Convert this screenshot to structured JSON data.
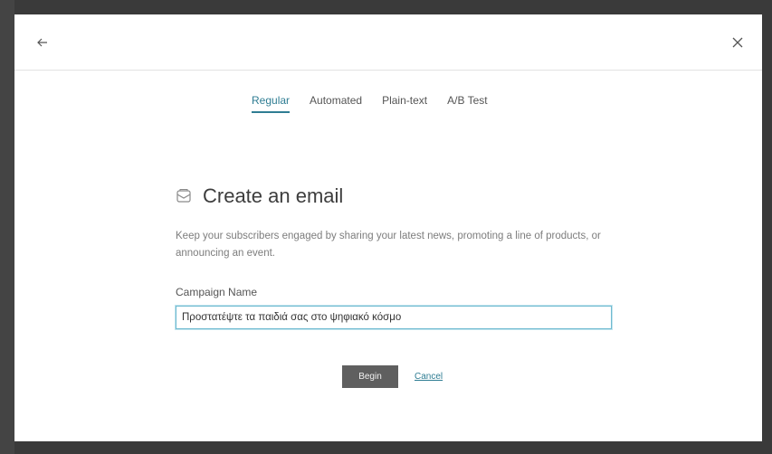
{
  "header": {
    "back_icon": "arrow-left-icon",
    "close_icon": "close-icon"
  },
  "tabs": [
    {
      "label": "Regular",
      "active": true
    },
    {
      "label": "Automated",
      "active": false
    },
    {
      "label": "Plain-text",
      "active": false
    },
    {
      "label": "A/B Test",
      "active": false
    }
  ],
  "main": {
    "icon": "email-icon",
    "title": "Create an email",
    "description": "Keep your subscribers engaged by sharing your latest news, promoting a line of products, or announcing an event.",
    "field_label": "Campaign Name",
    "field_value": "Προστατέψτε τα παιδιά σας στο ψηφιακό κόσμο",
    "begin_label": "Begin",
    "cancel_label": "Cancel"
  },
  "colors": {
    "accent": "#2f7d93",
    "button_bg": "#5f5f5f",
    "input_border": "#6fbad0"
  }
}
